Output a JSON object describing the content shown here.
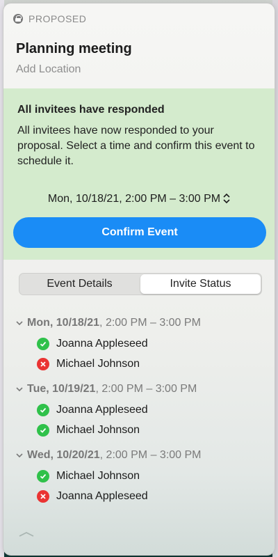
{
  "header": {
    "status": "PROPOSED",
    "title": "Planning meeting",
    "location_placeholder": "Add Location"
  },
  "banner": {
    "heading": "All invitees have responded",
    "body": "All invitees have now responded to your proposal. Select a time and confirm this event to schedule it.",
    "selected_time": "Mon, 10/18/21, 2:00 PM – 3:00 PM",
    "confirm_label": "Confirm Event",
    "background": "#d4ebcd",
    "button_color": "#1a8cf6"
  },
  "tabs": [
    {
      "label": "Event Details",
      "active": false
    },
    {
      "label": "Invite Status",
      "active": true
    }
  ],
  "days": [
    {
      "date": "Mon, 10/18/21",
      "time": ", 2:00 PM – 3:00 PM",
      "invitees": [
        {
          "name": "Joanna Appleseed",
          "status": "accepted"
        },
        {
          "name": "Michael Johnson",
          "status": "declined"
        }
      ]
    },
    {
      "date": "Tue, 10/19/21",
      "time": ", 2:00 PM – 3:00 PM",
      "invitees": [
        {
          "name": "Joanna Appleseed",
          "status": "accepted"
        },
        {
          "name": "Michael Johnson",
          "status": "accepted"
        }
      ]
    },
    {
      "date": "Wed, 10/20/21",
      "time": ", 2:00 PM – 3:00 PM",
      "invitees": [
        {
          "name": "Michael Johnson",
          "status": "accepted"
        },
        {
          "name": "Joanna Appleseed",
          "status": "declined"
        }
      ]
    }
  ],
  "icons": {
    "accepted": "checkmark-circle-icon",
    "declined": "x-circle-icon",
    "status": "lock-icon",
    "collapse": "chevron-down-icon",
    "time_picker": "updown-chevron-icon",
    "handle": "chevron-up-icon"
  },
  "colors": {
    "accepted": "#2fc14a",
    "declined": "#ea3332"
  }
}
